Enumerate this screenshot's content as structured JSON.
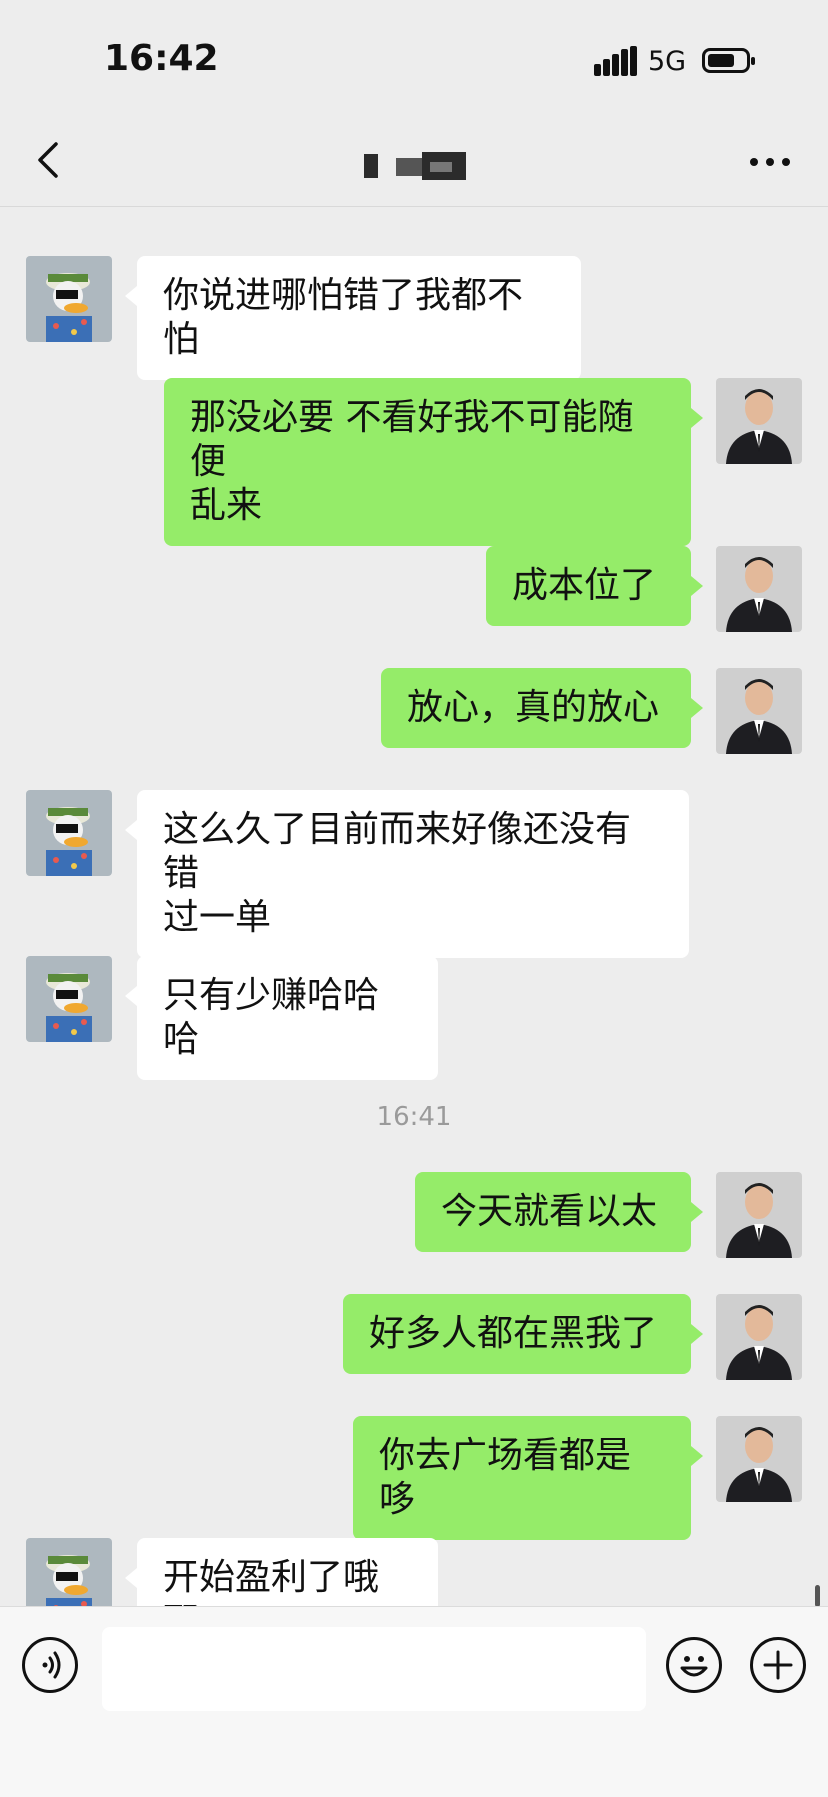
{
  "status_bar": {
    "time": "16:42",
    "network": "5G",
    "signal_icon": "signal-bars-icon",
    "battery_icon": "battery-icon"
  },
  "nav": {
    "back_icon": "chevron-left-icon",
    "title_redacted": true,
    "more_icon": "more-dots-icon"
  },
  "messages": [
    {
      "side": "in",
      "text": "你说进哪怕错了我都不怕"
    },
    {
      "side": "out",
      "text": "那没必要 不看好我不可能随便\n乱来"
    },
    {
      "side": "out",
      "text": "成本位了"
    },
    {
      "side": "out",
      "text": "放心，真的放心"
    },
    {
      "side": "in",
      "text": "这么久了目前而来好像还没有错\n过一单"
    },
    {
      "side": "in",
      "text": "只有少赚哈哈哈"
    },
    {
      "side": "out",
      "text": "今天就看以太"
    },
    {
      "side": "out",
      "text": "好多人都在黑我了"
    },
    {
      "side": "out",
      "text": "你去广场看都是哆"
    },
    {
      "side": "in",
      "text": "开始盈利了哦耶"
    }
  ],
  "time_divider": "16:41",
  "input_bar": {
    "voice_icon": "voice-icon",
    "emoji_icon": "emoji-icon",
    "plus_icon": "plus-icon",
    "text_value": ""
  },
  "colors": {
    "background": "#ededed",
    "outgoing_bubble": "#95ec69",
    "incoming_bubble": "#ffffff"
  }
}
